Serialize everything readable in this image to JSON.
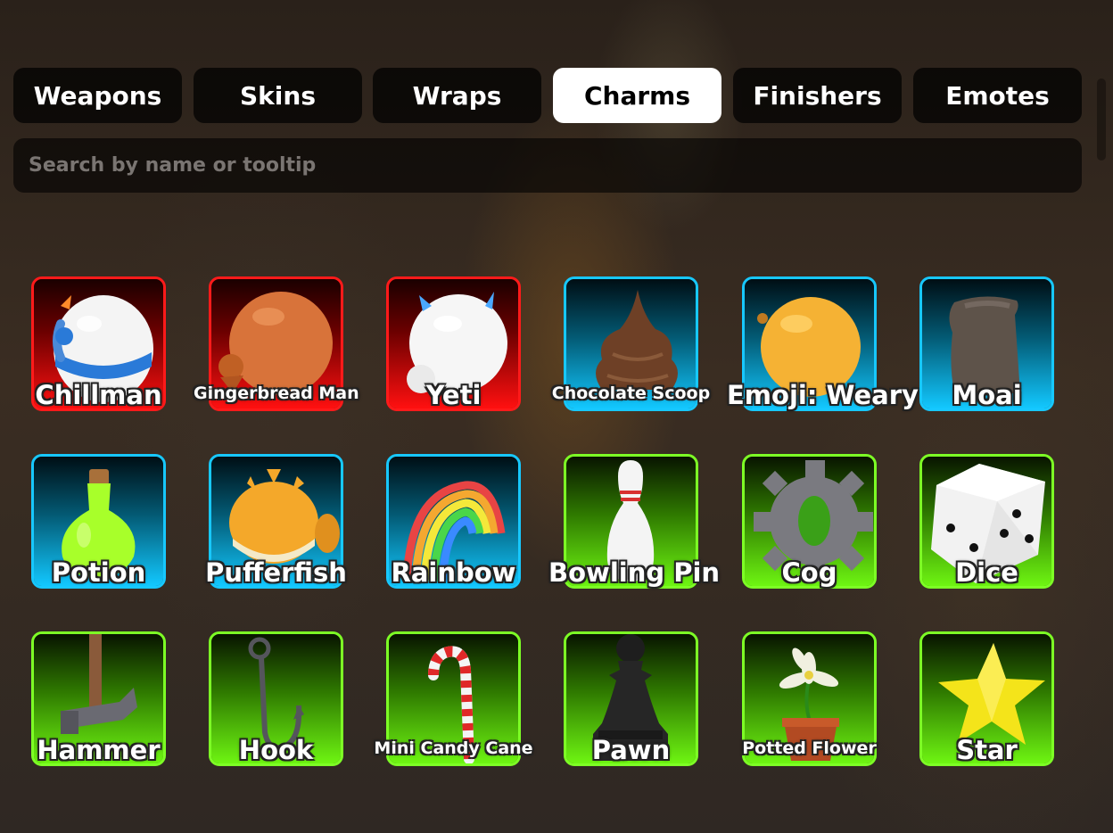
{
  "tabs": [
    {
      "label": "Weapons",
      "active": false
    },
    {
      "label": "Skins",
      "active": false
    },
    {
      "label": "Wraps",
      "active": false
    },
    {
      "label": "Charms",
      "active": true
    },
    {
      "label": "Finishers",
      "active": false
    },
    {
      "label": "Emotes",
      "active": false
    }
  ],
  "search": {
    "placeholder": "Search by name or tooltip",
    "value": ""
  },
  "charms": [
    {
      "name": "Chillman",
      "rarity": "red",
      "icon": "snowman-head-icon"
    },
    {
      "name": "Gingerbread Man",
      "rarity": "red",
      "icon": "gingerbread-ball-icon"
    },
    {
      "name": "Yeti",
      "rarity": "red",
      "icon": "yeti-icon"
    },
    {
      "name": "Chocolate Scoop",
      "rarity": "cyan",
      "icon": "chocolate-scoop-icon"
    },
    {
      "name": "Emoji: Weary",
      "rarity": "cyan",
      "icon": "emoji-ball-icon"
    },
    {
      "name": "Moai",
      "rarity": "cyan",
      "icon": "moai-icon"
    },
    {
      "name": "Potion",
      "rarity": "cyan",
      "icon": "potion-icon"
    },
    {
      "name": "Pufferfish",
      "rarity": "cyan",
      "icon": "pufferfish-icon"
    },
    {
      "name": "Rainbow",
      "rarity": "cyan",
      "icon": "rainbow-icon"
    },
    {
      "name": "Bowling Pin",
      "rarity": "green",
      "icon": "bowling-pin-icon"
    },
    {
      "name": "Cog",
      "rarity": "green",
      "icon": "cog-icon"
    },
    {
      "name": "Dice",
      "rarity": "green",
      "icon": "dice-icon"
    },
    {
      "name": "Hammer",
      "rarity": "green",
      "icon": "hammer-icon"
    },
    {
      "name": "Hook",
      "rarity": "green",
      "icon": "hook-icon"
    },
    {
      "name": "Mini Candy Cane",
      "rarity": "green",
      "icon": "candy-cane-icon"
    },
    {
      "name": "Pawn",
      "rarity": "green",
      "icon": "pawn-icon"
    },
    {
      "name": "Potted Flower",
      "rarity": "green",
      "icon": "potted-flower-icon"
    },
    {
      "name": "Star",
      "rarity": "green",
      "icon": "star-icon"
    }
  ],
  "colors": {
    "red": "#ff1a1a",
    "cyan": "#17c8ff",
    "green": "#7dff25"
  }
}
